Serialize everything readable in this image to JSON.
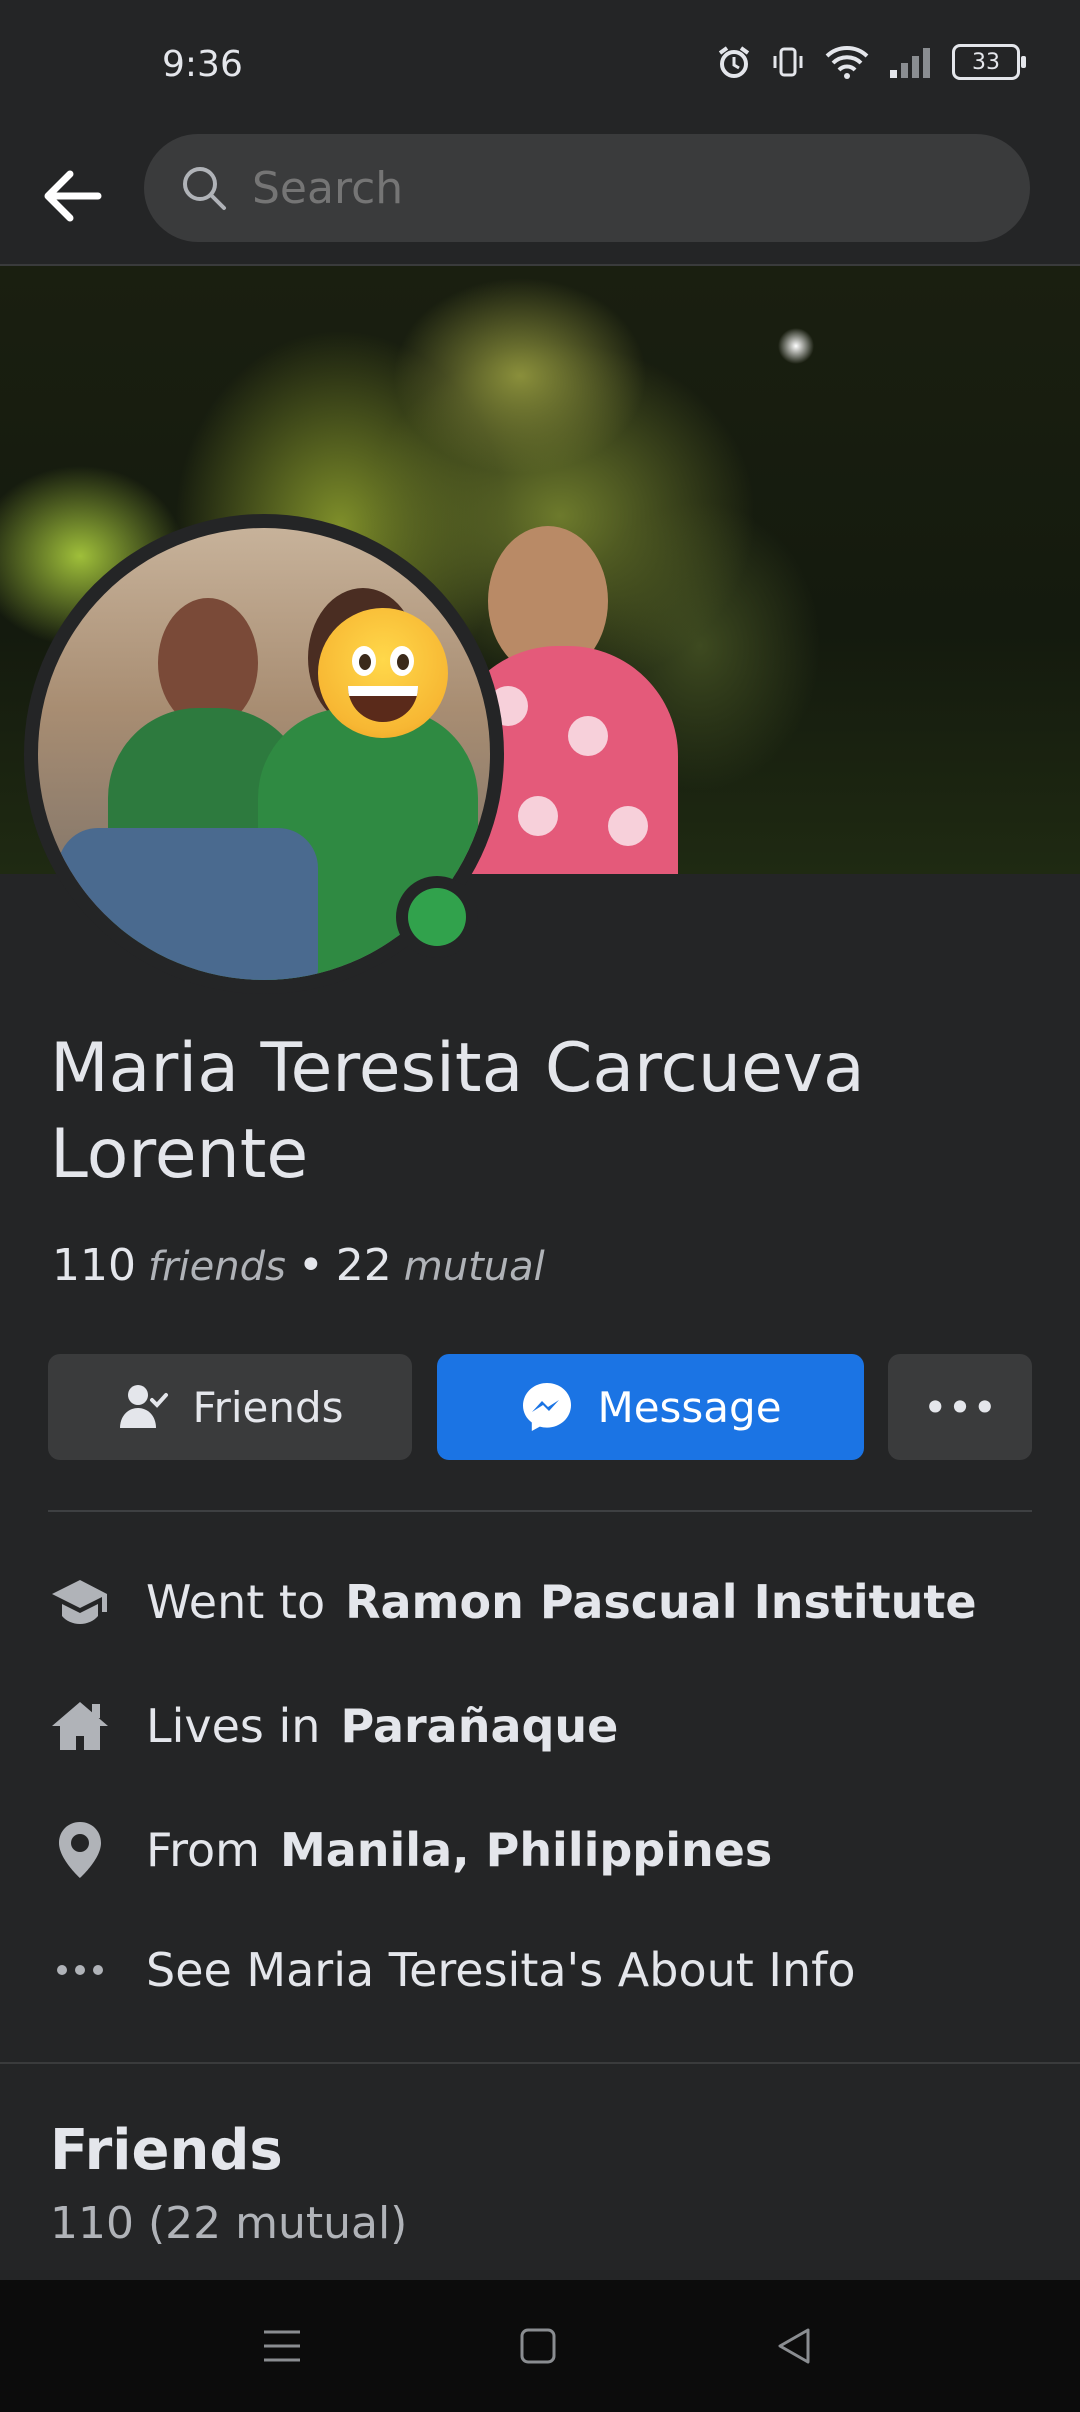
{
  "status_bar": {
    "time": "9:36",
    "battery": "33"
  },
  "search": {
    "placeholder": "Search"
  },
  "profile": {
    "name": "Maria Teresita Carcueva Lorente",
    "friends_count": "110",
    "friends_label": "friends",
    "separator": "•",
    "mutual_count": "22",
    "mutual_label": "mutual"
  },
  "actions": {
    "friends_label": "Friends",
    "message_label": "Message",
    "more_label": "•••"
  },
  "info": [
    {
      "icon": "graduation-cap-icon",
      "prefix": "Went to",
      "value": "Ramon Pascual Institute"
    },
    {
      "icon": "home-icon",
      "prefix": "Lives in",
      "value": "Parañaque"
    },
    {
      "icon": "location-pin-icon",
      "prefix": "From",
      "value": "Manila, Philippines"
    },
    {
      "icon": "more-dots-icon",
      "prefix": "See Maria Teresita's About Info",
      "value": ""
    }
  ],
  "friends_section": {
    "title": "Friends",
    "subtitle": "110 (22 mutual)"
  },
  "colors": {
    "background": "#242526",
    "accent": "#1b74e4",
    "online": "#31a24c",
    "surface": "#3a3b3c"
  }
}
